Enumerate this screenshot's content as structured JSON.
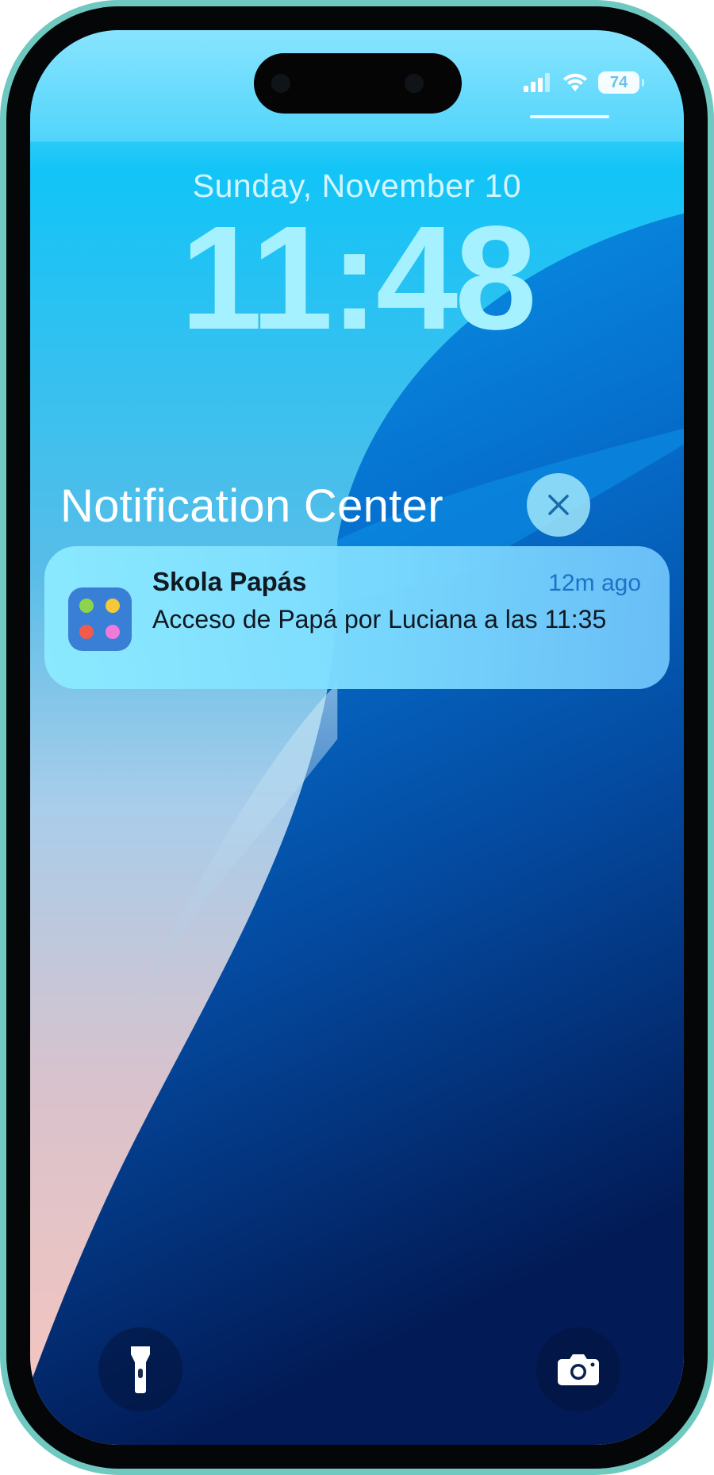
{
  "status_bar": {
    "battery_level": "74",
    "signal_icon": "cellular-signal-icon",
    "wifi_icon": "wifi-icon",
    "battery_icon": "battery-icon"
  },
  "lock_screen": {
    "date": "Sunday, November 10",
    "time": "11:48"
  },
  "notification_center": {
    "title": "Notification Center",
    "close_icon": "close-icon"
  },
  "notifications": [
    {
      "app_name": "Skola Papás",
      "time_ago": "12m ago",
      "message": "Acceso de Papá por Luciana a las 11:35",
      "app_icon": "skola-app-icon"
    }
  ],
  "quick_actions": {
    "left_icon": "flashlight-icon",
    "right_icon": "camera-icon"
  },
  "colors": {
    "frame": "#6fc9c0",
    "clock": "#a5f1ff",
    "notification_time": "#1d72c7",
    "app_icon_bg": "#3a7fd6",
    "app_dots": [
      "#8bd44c",
      "#f3c93a",
      "#f25a4c",
      "#f07ad8"
    ]
  }
}
